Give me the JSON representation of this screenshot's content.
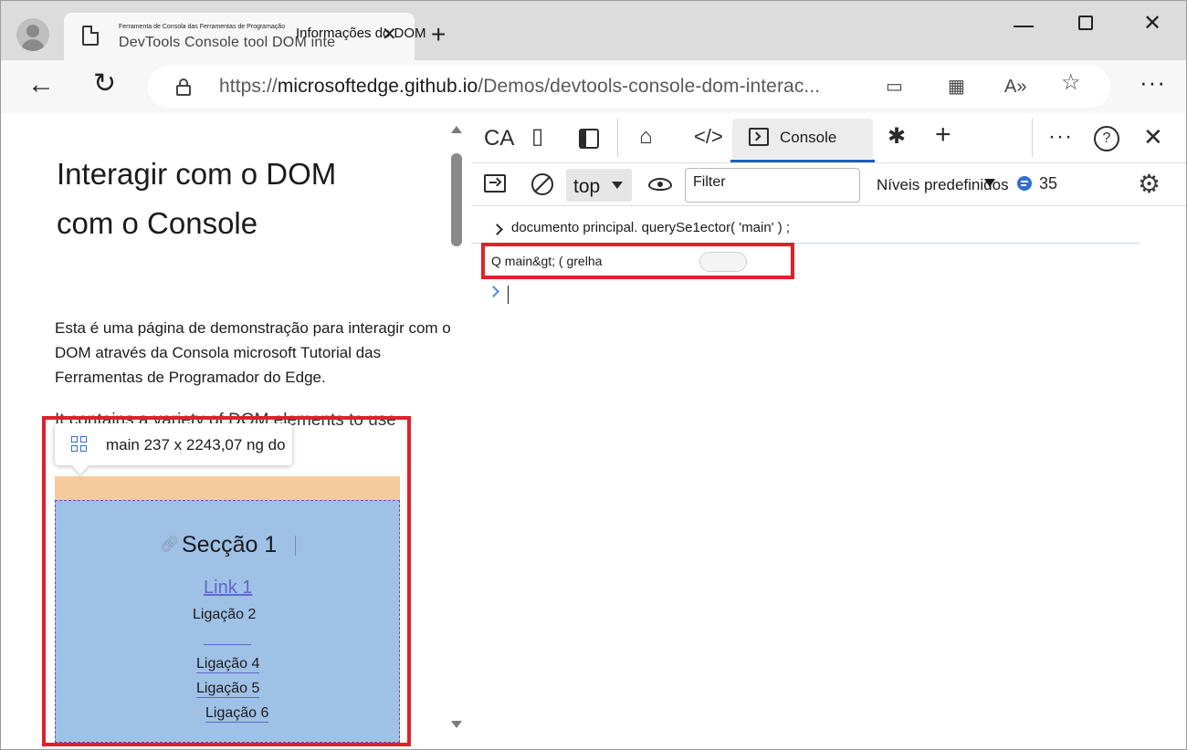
{
  "browser": {
    "tab": {
      "subtitle": "Ferramenta de Consola das Ferramentas de Programação",
      "title_underlay": "DevTools Console tool DOM inte",
      "title": "Informações do DOM"
    },
    "address": {
      "url_prefix": "https://",
      "url_host": "microsoftedge.github.io",
      "url_path": "/Demos/devtools-console-dom-interac..."
    }
  },
  "page": {
    "heading": "Interagir com o DOM com o Console",
    "intro": "Esta é uma página de demonstração para interagir com o DOM através da Consola microsoft Tutorial das Ferramentas de Programador do Edge.",
    "paragraph2": "It contains a variety of DOM elements to use in the Console.",
    "tooltip": "main 237 x 2243,07 ng do",
    "section_title": "Secção 1",
    "links": [
      "Link 1",
      "Ligação 2",
      "Ligação 4",
      "Ligação 5",
      "Ligação 6"
    ]
  },
  "devtools": {
    "ca_label": "CA",
    "console_tab": "Console",
    "help_glyph": "?",
    "context": "top",
    "filter_placeholder": "Filter",
    "levels": "Níveis predefinidos",
    "message_count": "35",
    "console": {
      "command": "documento principal. querySe1ector( 'main' ) ;",
      "result": "Q main&gt; ( grelha"
    }
  },
  "colors": {
    "highlight_margin": "#f6cb9d",
    "highlight_content": "#9fc1e6",
    "annotation_red": "#e0202b",
    "accent_blue": "#1f5fbf"
  }
}
